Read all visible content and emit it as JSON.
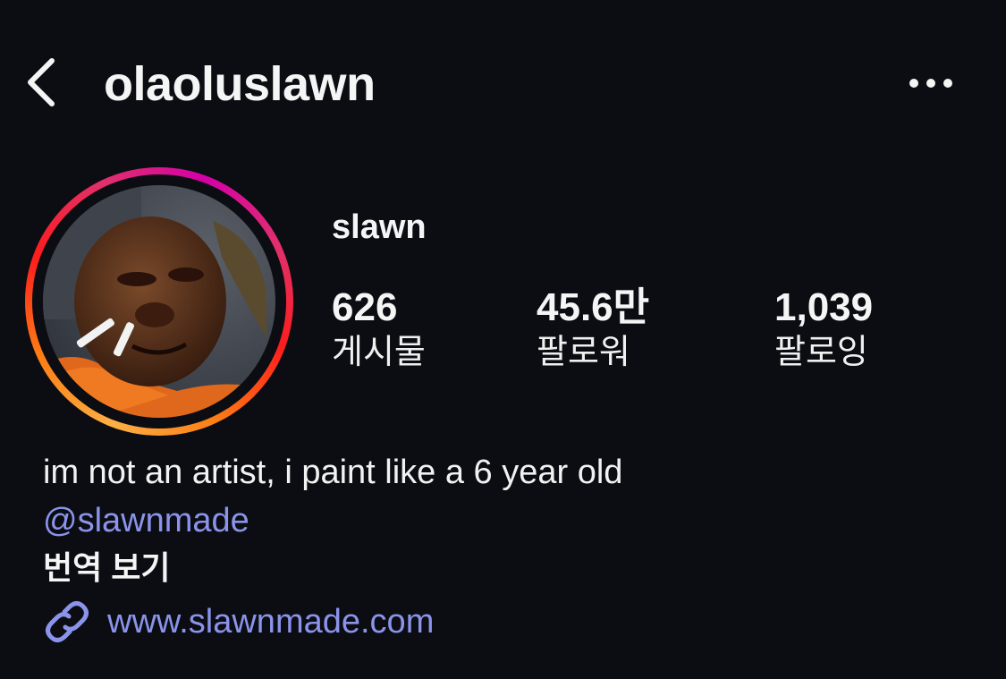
{
  "header": {
    "username": "olaoluslawn",
    "back_icon": "chevron-left-icon",
    "more_icon": "more-horizontal-icon"
  },
  "profile": {
    "display_name": "slawn",
    "avatar_icon": "profile-photo",
    "story_ring_colors": [
      "#fcb045",
      "#fd1d1d",
      "#d400a8"
    ]
  },
  "stats": [
    {
      "value": "626",
      "label": "게시물"
    },
    {
      "value": "45.6만",
      "label": "팔로워"
    },
    {
      "value": "1,039",
      "label": "팔로잉"
    }
  ],
  "bio": {
    "text": "im not an artist, i paint like a 6 year old",
    "mention": "@slawnmade",
    "translate_label": "번역 보기",
    "link_icon": "link-icon",
    "link": "www.slawnmade.com"
  },
  "colors": {
    "background": "#0b0d12",
    "link": "#8b93ea",
    "text": "#f5f5f5"
  }
}
